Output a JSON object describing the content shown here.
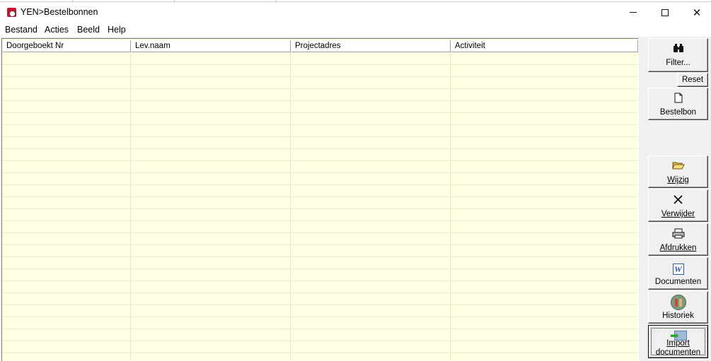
{
  "window": {
    "title": "YEN>Bestelbonnen",
    "minimize": "─",
    "maximize": "☐",
    "close": "✕"
  },
  "menu": [
    {
      "label": "Bestand"
    },
    {
      "label": "Acties"
    },
    {
      "label": "Beeld"
    },
    {
      "label": "Help"
    }
  ],
  "grid": {
    "columns": [
      {
        "label": "Doorgeboekt  Nr"
      },
      {
        "label": "Lev.naam"
      },
      {
        "label": "Projectadres"
      },
      {
        "label": "Activiteit"
      }
    ],
    "rows": [],
    "background_color": "#ffffe3"
  },
  "sidebar": {
    "filter": {
      "label": "Filter...",
      "icon": "binoculars-icon"
    },
    "reset": {
      "label": "Reset"
    },
    "bestelbon": {
      "label": "Bestelbon",
      "icon": "new-document-icon"
    },
    "wijzig": {
      "label": "Wijzig",
      "icon": "open-folder-icon"
    },
    "verwijder": {
      "label": "Verwijder",
      "icon": "delete-x-icon"
    },
    "afdrukken": {
      "label": "Afdrukken",
      "icon": "printer-icon"
    },
    "documenten": {
      "label": "Documenten",
      "icon": "word-document-icon"
    },
    "historiek": {
      "label": "Historiek",
      "icon": "history-archive-icon"
    },
    "import": {
      "label_line1": "Import",
      "label_line2": "documenten",
      "icon": "import-arrow-icon"
    }
  }
}
